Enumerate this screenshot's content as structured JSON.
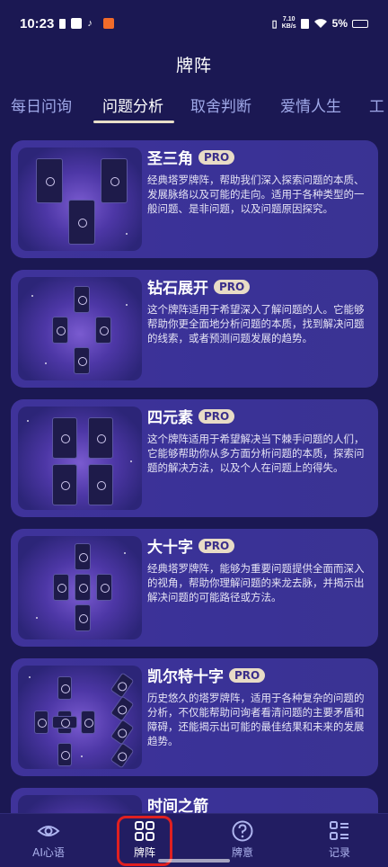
{
  "status": {
    "time": "10:23",
    "net_speed_value": "7.10",
    "net_speed_unit": "KB/s",
    "battery": "5%"
  },
  "header": {
    "title": "牌阵"
  },
  "tabs": [
    {
      "label": "每日问询",
      "active": false
    },
    {
      "label": "问题分析",
      "active": true
    },
    {
      "label": "取舍判断",
      "active": false
    },
    {
      "label": "爱情人生",
      "active": false
    },
    {
      "label": "工",
      "active": false
    }
  ],
  "spreads": [
    {
      "title": "圣三角",
      "badge": "PRO",
      "description": "经典塔罗牌阵，帮助我们深入探索问题的本质、发展脉络以及可能的走向。适用于各种类型的一般问题、是非问题，以及问题原因探究。"
    },
    {
      "title": "钻石展开",
      "badge": "PRO",
      "description": "这个牌阵适用于希望深入了解问题的人。它能够帮助你更全面地分析问题的本质，找到解决问题的线索，或者预测问题发展的趋势。"
    },
    {
      "title": "四元素",
      "badge": "PRO",
      "description": "这个牌阵适用于希望解决当下棘手问题的人们，它能够帮助你从多方面分析问题的本质，探索问题的解决方法，以及个人在问题上的得失。"
    },
    {
      "title": "大十字",
      "badge": "PRO",
      "description": "经典塔罗牌阵，能够为重要问题提供全面而深入的视角，帮助你理解问题的来龙去脉，并揭示出解决问题的可能路径或方法。"
    },
    {
      "title": "凯尔特十字",
      "badge": "PRO",
      "description": "历史悠久的塔罗牌阵，适用于各种复杂的问题的分析，不仅能帮助问询者看清问题的主要矛盾和障碍，还能揭示出可能的最佳结果和未来的发展趋势。"
    },
    {
      "title": "时间之箭",
      "badge": "",
      "description": ""
    }
  ],
  "bottom_nav": [
    {
      "label": "AI心语",
      "icon": "eye-icon",
      "active": false
    },
    {
      "label": "牌阵",
      "icon": "grid-icon",
      "active": true
    },
    {
      "label": "牌意",
      "icon": "question-icon",
      "active": false
    },
    {
      "label": "记录",
      "icon": "list-icon",
      "active": false
    }
  ],
  "colors": {
    "background": "#1b1853",
    "card": "#3a3297",
    "badge": "#e8dcc6",
    "highlight": "#e02020"
  }
}
